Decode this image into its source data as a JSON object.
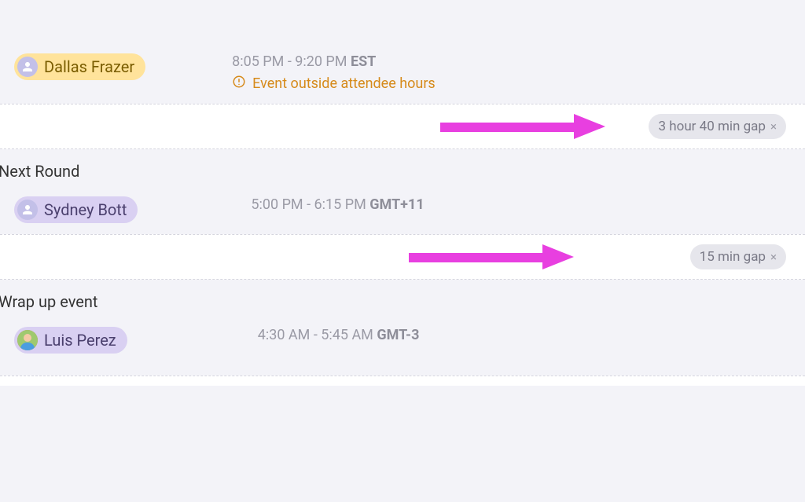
{
  "attendees": {
    "a1": {
      "name": "Dallas Frazer"
    },
    "a2": {
      "name": "Sydney Bott"
    },
    "a3": {
      "name": "Luis Perez"
    }
  },
  "events": {
    "e1": {
      "time": "8:05 PM - 9:20 PM",
      "tz": "EST",
      "warning": "Event outside attendee hours"
    },
    "e2": {
      "time": "5:00 PM - 6:15 PM",
      "tz": "GMT+11"
    },
    "e3": {
      "time": "4:30 AM - 5:45 AM",
      "tz": "GMT-3"
    }
  },
  "sections": {
    "s2": {
      "title": "Next Round"
    },
    "s3": {
      "title": "Wrap up event"
    }
  },
  "gaps": {
    "g1": {
      "label": "3 hour 40 min gap"
    },
    "g2": {
      "label": "15 min gap"
    }
  }
}
